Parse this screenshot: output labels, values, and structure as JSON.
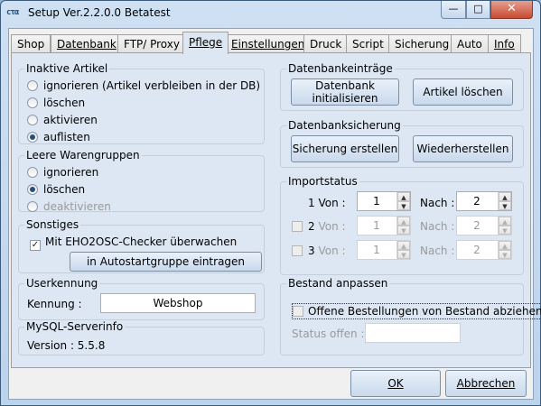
{
  "window": {
    "app_icon_text": "cτα",
    "title": "Setup Ver.2.2.0.0 Betatest",
    "min_symbol": "—",
    "max_symbol": "□",
    "close_symbol": "✕"
  },
  "tabs": [
    {
      "label": "Shop"
    },
    {
      "label": "Datenbank"
    },
    {
      "label": "FTP/ Proxy"
    },
    {
      "label": "Pflege"
    },
    {
      "label": "Einstellungen"
    },
    {
      "label": "Druck"
    },
    {
      "label": "Script"
    },
    {
      "label": "Sicherung"
    },
    {
      "label": "Auto"
    },
    {
      "label": "Info"
    }
  ],
  "inaktive": {
    "title": "Inaktive Artikel",
    "options": [
      "ignorieren (Artikel verbleiben in der DB)",
      "löschen",
      "aktivieren",
      "auflisten"
    ],
    "selected": "auflisten"
  },
  "leere": {
    "title": "Leere Warengruppen",
    "options": [
      "ignorieren",
      "löschen",
      "deaktivieren"
    ],
    "selected": "löschen"
  },
  "sonstiges": {
    "title": "Sonstiges",
    "checker_label": "Mit EHO2OSC-Checker überwachen",
    "checker_checked": true,
    "checker_mark": "✓",
    "autostart_button": "in Autostartgruppe eintragen"
  },
  "userkennung": {
    "title": "Userkennung",
    "label": "Kennung :",
    "value": "Webshop"
  },
  "mysql": {
    "title": "MySQL-Serverinfo",
    "version": "Version : 5.5.8"
  },
  "db_eintraege": {
    "title": "Datenbankeinträge",
    "init_button_line1": "Datenbank",
    "init_button_line2": "initialisieren",
    "delete_button": "Artikel löschen"
  },
  "db_sicherung": {
    "title": "Datenbanksicherung",
    "create_button": "Sicherung erstellen",
    "restore_button": "Wiederherstellen"
  },
  "importstatus": {
    "title": "Importstatus",
    "rows": [
      {
        "num": "1",
        "von_label": "Von :",
        "von": "1",
        "nach_label": "Nach :",
        "nach": "2"
      },
      {
        "num": "2",
        "von_label": "Von :",
        "von": "1",
        "nach_label": "Nach :",
        "nach": "2"
      },
      {
        "num": "3",
        "von_label": "Von :",
        "von": "1",
        "nach_label": "Nach :",
        "nach": "2"
      }
    ]
  },
  "bestand": {
    "title": "Bestand anpassen",
    "checkbox_label": "Offene Bestellungen von Bestand abziehen",
    "status_label": "Status offen :",
    "status_value": ""
  },
  "footer": {
    "ok": "OK",
    "cancel": "Abbrechen"
  }
}
